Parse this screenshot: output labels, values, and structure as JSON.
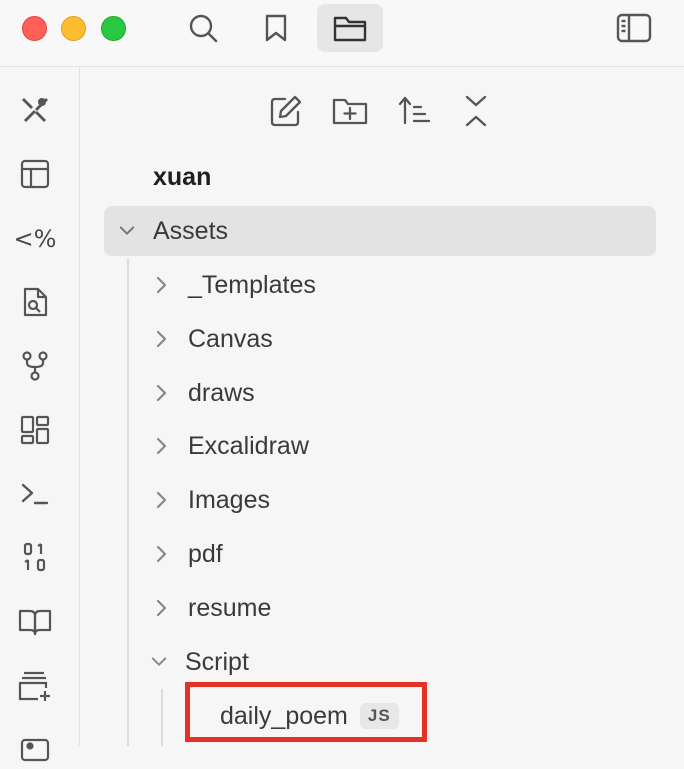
{
  "titlebar": {
    "buttons": [
      "search-icon",
      "bookmark-icon",
      "folder-icon",
      "sidebar-toggle-icon"
    ]
  },
  "ribbon": {
    "items": [
      {
        "icon": "plugin-tools-icon"
      },
      {
        "icon": "layout-template-icon"
      },
      {
        "icon": "templater-icon",
        "text": "<%"
      },
      {
        "icon": "file-search-icon"
      },
      {
        "icon": "git-branch-icon"
      },
      {
        "icon": "dashboard-grid-icon"
      },
      {
        "icon": "terminal-icon"
      },
      {
        "icon": "binary-icon"
      },
      {
        "icon": "book-open-icon"
      },
      {
        "icon": "add-card-icon"
      },
      {
        "icon": "image-card-icon"
      }
    ]
  },
  "explorer": {
    "nav": [
      "new-note-icon",
      "new-folder-icon",
      "sort-icon",
      "collapse-all-icon"
    ],
    "vault_name": "xuan",
    "root_folder": "Assets",
    "folders": [
      "_Templates",
      "Canvas",
      "draws",
      "Excalidraw",
      "Images",
      "pdf",
      "resume"
    ],
    "open_folder": "Script",
    "files": [
      {
        "name": "daily_poem",
        "ext": "JS"
      }
    ]
  },
  "colors": {
    "highlight": "#e53127",
    "selected_bg": "#e3e3e3"
  }
}
